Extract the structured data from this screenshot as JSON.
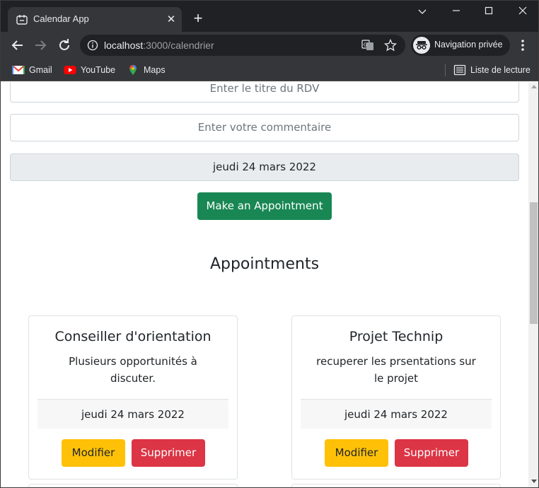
{
  "browser": {
    "tab_title": "Calendar App",
    "url_host": "localhost",
    "url_path": ":3000/calendrier",
    "incognito_label": "Navigation privée",
    "bookmarks": [
      {
        "label": "Gmail",
        "icon": "gmail-icon"
      },
      {
        "label": "YouTube",
        "icon": "youtube-icon"
      },
      {
        "label": "Maps",
        "icon": "maps-icon"
      }
    ],
    "reading_list": "Liste de lecture"
  },
  "form": {
    "title_placeholder": "Enter le titre du RDV",
    "comment_placeholder": "Enter votre commentaire",
    "date_value": "jeudi 24 mars 2022",
    "submit_label": "Make an Appointment"
  },
  "appointments": {
    "heading": "Appointments",
    "items": [
      {
        "title": "Conseiller d'orientation",
        "comment": "Plusieurs opportunités à discuter.",
        "date": "jeudi 24 mars 2022",
        "edit_label": "Modifier",
        "delete_label": "Supprimer"
      },
      {
        "title": "Projet Technip",
        "comment": "recuperer les prsentations sur le projet",
        "date": "jeudi 24 mars 2022",
        "edit_label": "Modifier",
        "delete_label": "Supprimer"
      }
    ]
  },
  "colors": {
    "success": "#198754",
    "warning": "#ffc107",
    "danger": "#dc3545",
    "chrome_dark": "#202124"
  }
}
